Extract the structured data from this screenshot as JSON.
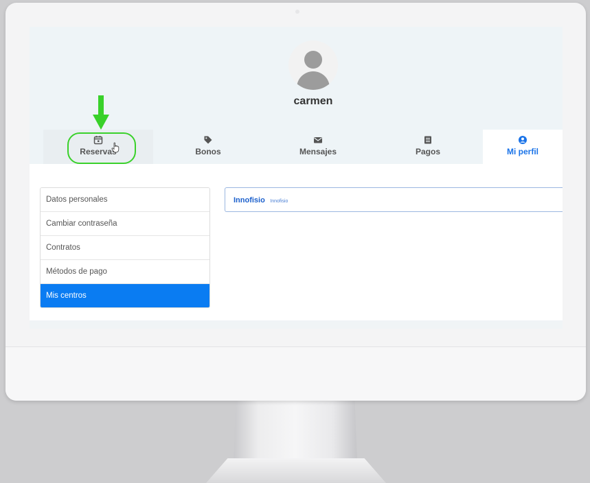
{
  "user": {
    "name": "carmen"
  },
  "tabs": [
    {
      "id": "reservas",
      "label": "Reservas",
      "icon": "calendar-icon"
    },
    {
      "id": "bonos",
      "label": "Bonos",
      "icon": "tag-icon"
    },
    {
      "id": "mensajes",
      "label": "Mensajes",
      "icon": "envelope-icon"
    },
    {
      "id": "pagos",
      "label": "Pagos",
      "icon": "receipt-icon"
    },
    {
      "id": "perfil",
      "label": "Mi perfil",
      "icon": "user-circle-icon",
      "active": true
    }
  ],
  "side_menu": [
    {
      "label": "Datos personales"
    },
    {
      "label": "Cambiar contraseña"
    },
    {
      "label": "Contratos"
    },
    {
      "label": "Métodos de pago"
    },
    {
      "label": "Mis centros",
      "active": true
    }
  ],
  "centro": {
    "name": "Innofisio",
    "subtitle": "Innofisio"
  },
  "colors": {
    "accent": "#0a7cf2",
    "highlight": "#39d12a",
    "header_bg": "#eef4f7"
  }
}
